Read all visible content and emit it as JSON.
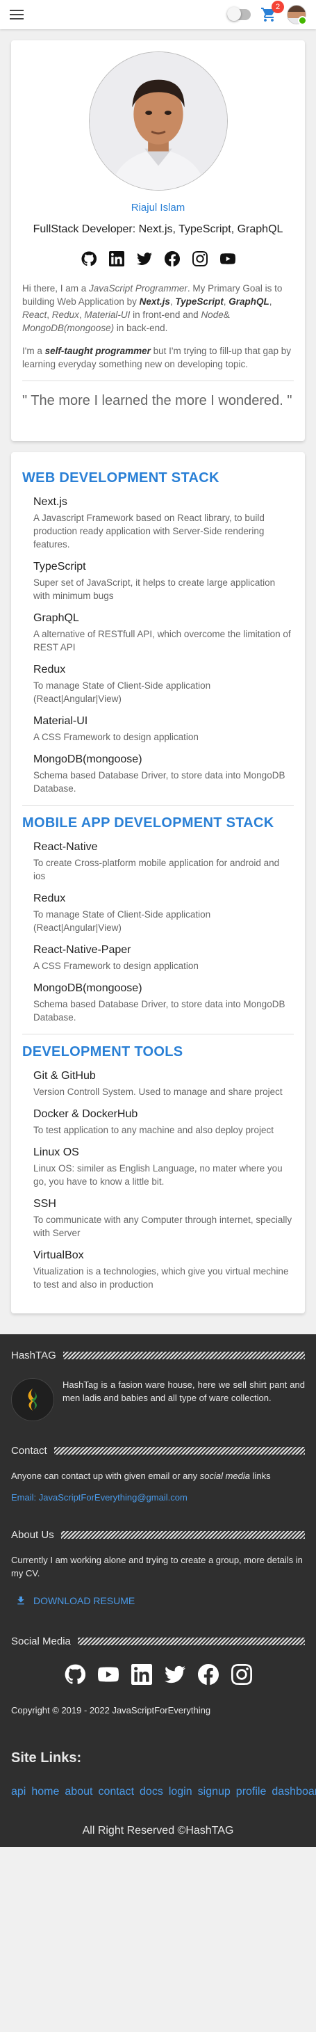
{
  "header": {
    "cart_count": "2",
    "icons": [
      "menu-icon",
      "theme-toggle",
      "cart-icon",
      "avatar"
    ]
  },
  "profile": {
    "name": "Riajul Islam",
    "tagline": "FullStack Developer: Next.js, TypeScript, GraphQL",
    "social_icons": [
      "github-icon",
      "linkedin-icon",
      "twitter-icon",
      "facebook-icon",
      "instagram-icon",
      "youtube-icon"
    ],
    "bio1": [
      {
        "t": "Hi there, I am a "
      },
      {
        "i": "JavaScript Programmer"
      },
      {
        "t": ". My Primary Goal is to building Web Application by "
      },
      {
        "bi": "Next.js"
      },
      {
        "t": ", "
      },
      {
        "bi": "TypeScript"
      },
      {
        "t": ", "
      },
      {
        "bi": "GraphQL"
      },
      {
        "t": ", "
      },
      {
        "i": "React"
      },
      {
        "t": ", "
      },
      {
        "i": "Redux"
      },
      {
        "t": ", "
      },
      {
        "i": "Material-UI"
      },
      {
        "t": " in front-end and "
      },
      {
        "i": "Node"
      },
      {
        "t": "& "
      },
      {
        "i": "MongoDB(mongoose)"
      },
      {
        "t": " in back-end."
      }
    ],
    "bio2": [
      {
        "t": "I'm a "
      },
      {
        "bi": "self-taught programmer"
      },
      {
        "t": " but I'm trying to fill-up that gap by learning everyday something new on developing topic."
      }
    ],
    "quote": "\" The more I learned the more I wondered. \""
  },
  "stacks": [
    {
      "title": "WEB DEVELOPMENT STACK",
      "items": [
        {
          "title": "Next.js",
          "desc": "A Javascript Framework based on React library, to build production ready application with Server-Side rendering features."
        },
        {
          "title": "TypeScript",
          "desc": "Super set of JavaScript, it helps to create large application with minimum bugs"
        },
        {
          "title": "GraphQL",
          "desc": "A alternative of RESTfull API, which overcome the limitation of REST API"
        },
        {
          "title": "Redux",
          "desc": "To manage State of Client-Side application (React|Angular|View)"
        },
        {
          "title": "Material-UI",
          "desc": "A CSS Framework to design application"
        },
        {
          "title": "MongoDB(mongoose)",
          "desc": "Schema based Database Driver, to store data into MongoDB Database."
        }
      ]
    },
    {
      "title": "MOBILE APP DEVELOPMENT STACK",
      "items": [
        {
          "title": "React-Native",
          "desc": "To create Cross-platform mobile application for android and ios"
        },
        {
          "title": "Redux",
          "desc": "To manage State of Client-Side application (React|Angular|View)"
        },
        {
          "title": "React-Native-Paper",
          "desc": "A CSS Framework to design application"
        },
        {
          "title": "MongoDB(mongoose)",
          "desc": "Schema based Database Driver, to store data into MongoDB Database."
        }
      ]
    },
    {
      "title": "DEVELOPMENT TOOLS",
      "items": [
        {
          "title": "Git & GitHub",
          "desc": "Version Controll System. Used to manage and share project"
        },
        {
          "title": "Docker & DockerHub",
          "desc": "To test application to any machine and also deploy project"
        },
        {
          "title": "Linux OS",
          "desc": "Linux OS: similer as English Language, no mater where you go, you have to know a little bit."
        },
        {
          "title": "SSH",
          "desc": "To communicate with any Computer through internet, specially with Server"
        },
        {
          "title": "VirtualBox",
          "desc": "Vitualization is a technologies, which give you virtual mechine to test and also in production"
        }
      ]
    }
  ],
  "footer": {
    "hashtag_title": "HashTAG",
    "hashtag_desc": "HashTag is a fasion ware house, here we sell shirt pant and men ladis and babies and all type of ware collection.",
    "contact_title": "Contact",
    "contact_text": [
      {
        "t": "Anyone can contact up with given email or any "
      },
      {
        "i": "social media"
      },
      {
        "t": " links"
      }
    ],
    "email": "Email: JavaScriptForEverything@gmail.com",
    "about_title": "About Us",
    "about_text": "Currently I am working alone and trying to create a group, more details in my CV.",
    "resume_label": "DOWNLOAD RESUME",
    "social_title": "Social Media",
    "social_icons": [
      "github-icon",
      "youtube-icon",
      "linkedin-icon",
      "twitter-icon",
      "facebook-icon",
      "instagram-icon"
    ],
    "copyright": "Copyright © 2019 - 2022 JavaScriptForEverything",
    "site_links_title": "Site Links:",
    "links": [
      "api",
      "home",
      "about",
      "contact",
      "docs",
      "login",
      "signup",
      "profile",
      "dashboard"
    ],
    "rights": "All Right Reserved ©HashTAG"
  },
  "colors": {
    "accent": "#2a80d6",
    "footer_bg": "#2f2f2f",
    "link": "#4a9ae8",
    "badge": "#f44336"
  }
}
